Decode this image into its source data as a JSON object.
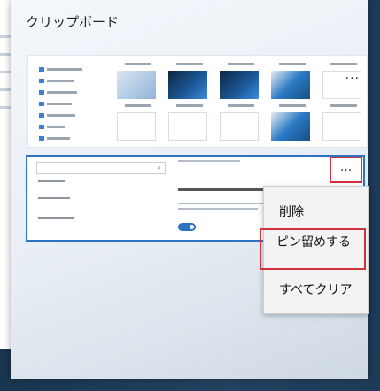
{
  "panel": {
    "title": "クリップボード"
  },
  "clip_items": [
    {
      "more_label": "..."
    },
    {
      "more_label": "..."
    }
  ],
  "context_menu": {
    "items": [
      {
        "label": "削除"
      },
      {
        "label": "ピン留めする"
      },
      {
        "label": "すべてクリア"
      }
    ]
  },
  "colors": {
    "accent": "#2d73c2",
    "highlight_box": "#d1323b"
  },
  "icons": [
    "more-options-icon",
    "search-icon",
    "toggle-switch-icon"
  ]
}
